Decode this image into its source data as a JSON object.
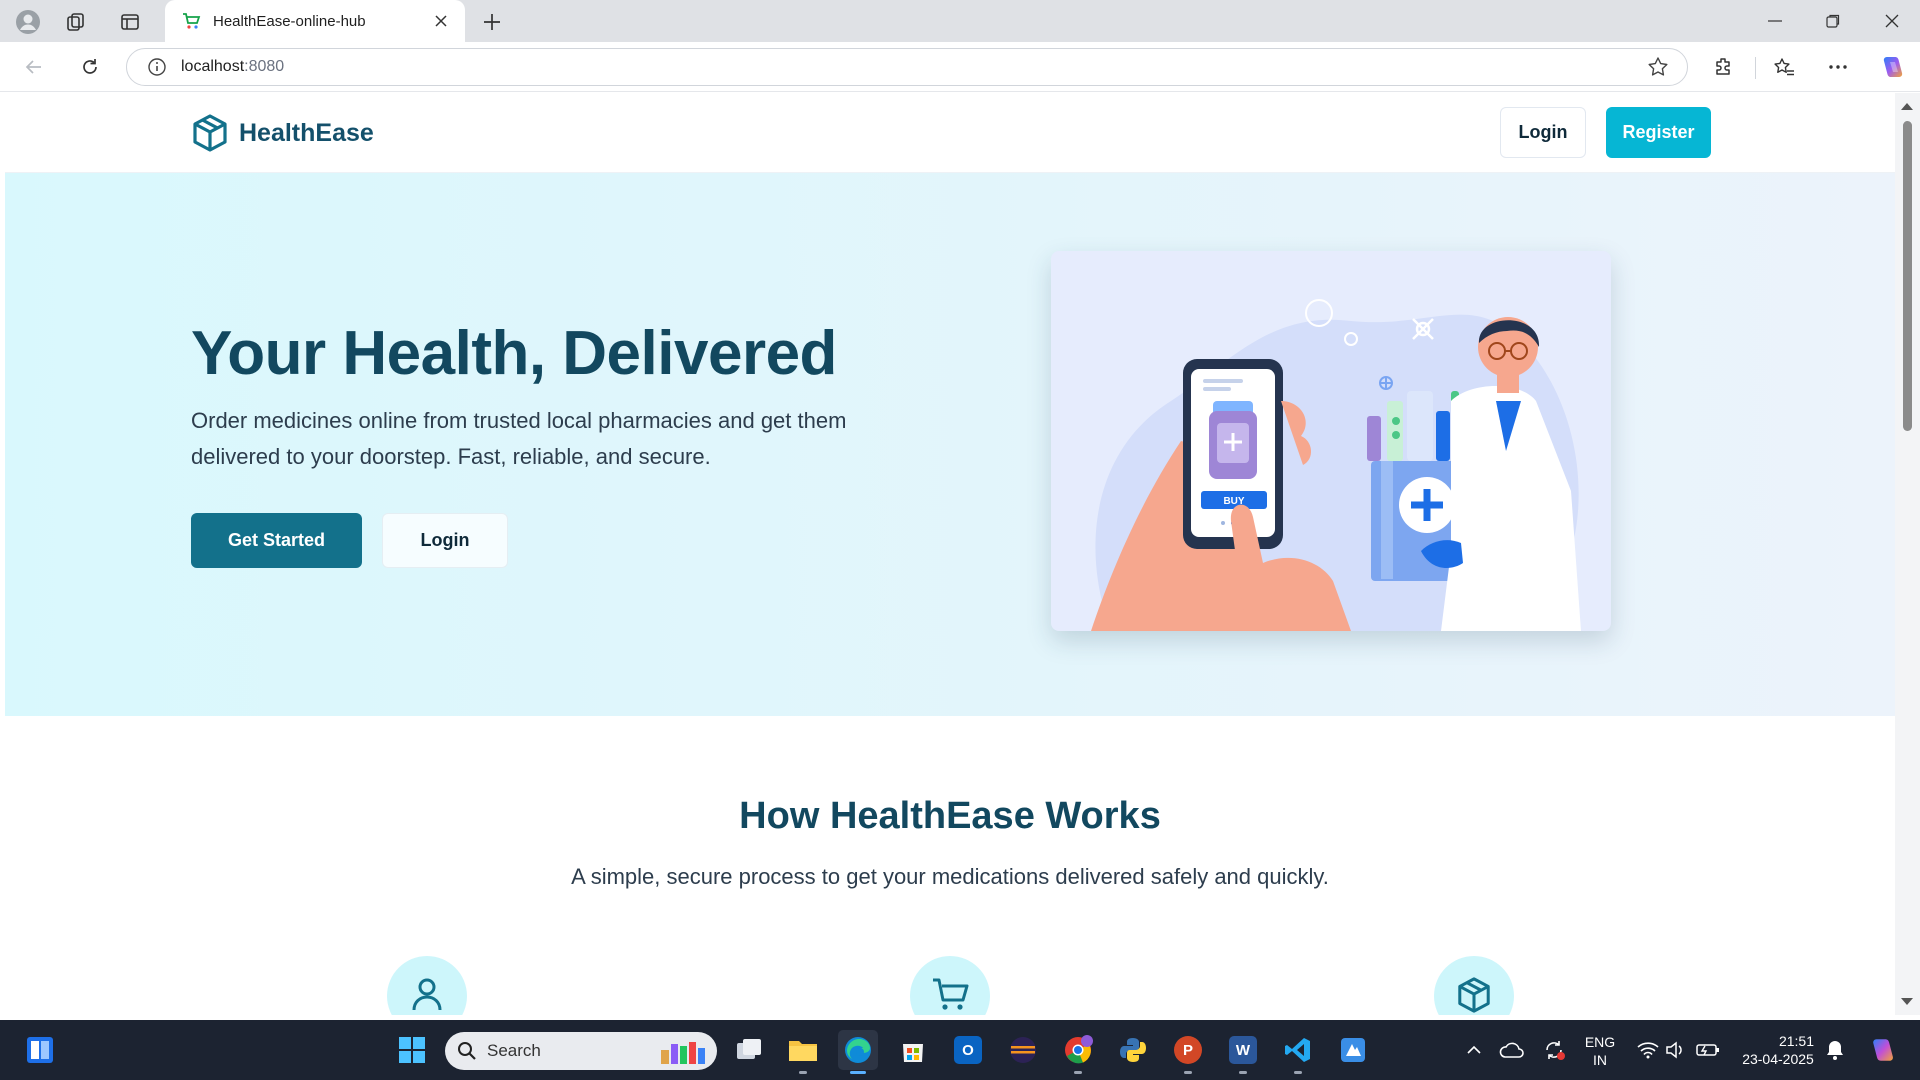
{
  "browser": {
    "tab_title": "HealthEase-online-hub",
    "url_host": "localhost",
    "url_port": ":8080"
  },
  "site": {
    "brand": "HealthEase",
    "header_login": "Login",
    "header_register": "Register",
    "hero": {
      "title": "Your Health, Delivered",
      "subtitle": "Order medicines online from trusted local pharmacies and get them delivered to your doorstep. Fast, reliable, and secure.",
      "primary_cta": "Get Started",
      "secondary_cta": "Login",
      "illustration_buy_label": "BUY"
    },
    "how": {
      "title": "How HealthEase Works",
      "subtitle": "A simple, secure process to get your medications delivered safely and quickly.",
      "step_icons": [
        "user-icon",
        "cart-icon",
        "box-icon"
      ]
    }
  },
  "taskbar": {
    "search_placeholder": "Search",
    "lang_top": "ENG",
    "lang_bottom": "IN",
    "time": "21:51",
    "date": "23-04-2025"
  },
  "colors": {
    "brand_dark": "#12485f",
    "accent_cyan": "#06b6d4",
    "primary_button": "#13718b",
    "hero_bg": "#d9f8fd"
  }
}
